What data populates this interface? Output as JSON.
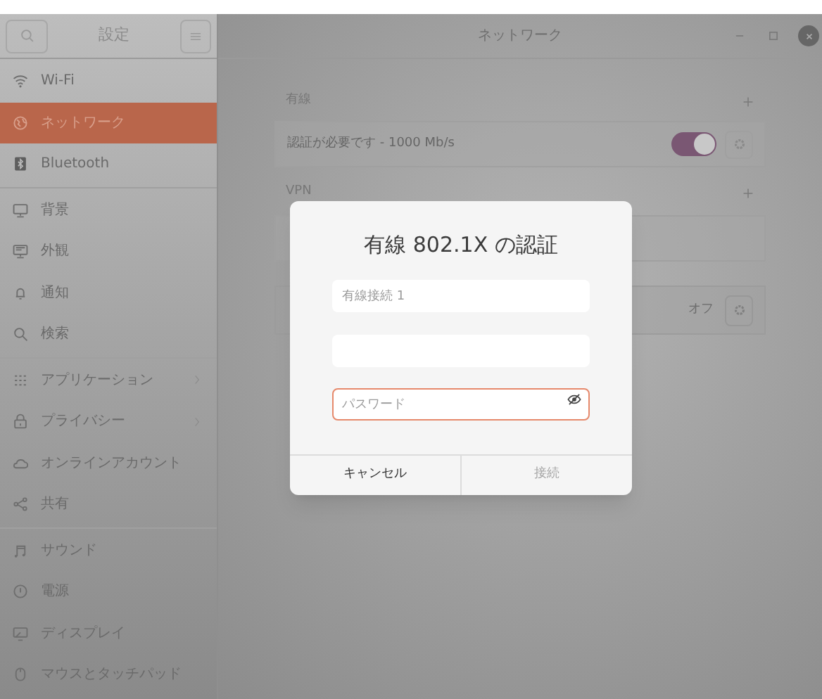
{
  "sidebar": {
    "title": "設定",
    "groups": [
      [
        {
          "label": "Wi-Fi",
          "selected": false,
          "submenu": false
        },
        {
          "label": "ネットワーク",
          "selected": true,
          "submenu": false
        },
        {
          "label": "Bluetooth",
          "selected": false,
          "submenu": false
        }
      ],
      [
        {
          "label": "背景",
          "selected": false,
          "submenu": false
        },
        {
          "label": "外観",
          "selected": false,
          "submenu": false
        },
        {
          "label": "通知",
          "selected": false,
          "submenu": false
        },
        {
          "label": "検索",
          "selected": false,
          "submenu": false
        }
      ],
      [
        {
          "label": "アプリケーション",
          "selected": false,
          "submenu": true
        },
        {
          "label": "プライバシー",
          "selected": false,
          "submenu": true
        },
        {
          "label": "オンラインアカウント",
          "selected": false,
          "submenu": false
        },
        {
          "label": "共有",
          "selected": false,
          "submenu": false
        }
      ],
      [
        {
          "label": "サウンド",
          "selected": false,
          "submenu": false
        },
        {
          "label": "電源",
          "selected": false,
          "submenu": false
        },
        {
          "label": "ディスプレイ",
          "selected": false,
          "submenu": false
        },
        {
          "label": "マウスとタッチパッド",
          "selected": false,
          "submenu": false
        }
      ]
    ]
  },
  "window": {
    "title": "ネットワーク"
  },
  "wired": {
    "title": "有線",
    "rows": [
      {
        "label": "認証が必要です - 1000 Mb/s",
        "on": true
      }
    ]
  },
  "vpn": {
    "title": "VPN"
  },
  "proxy": {
    "status": "オフ"
  },
  "dialog": {
    "title": "有線 802.1X の認証",
    "fields": [
      {
        "placeholder": "有線接続 1",
        "focused": false,
        "password": false
      },
      {
        "focused": false,
        "password": false
      },
      {
        "placeholder": "パスワード",
        "focused": true,
        "password": true
      }
    ],
    "buttons": [
      {
        "label": "キャンセル",
        "disabled": false
      },
      {
        "label": "接続",
        "disabled": true
      }
    ]
  }
}
